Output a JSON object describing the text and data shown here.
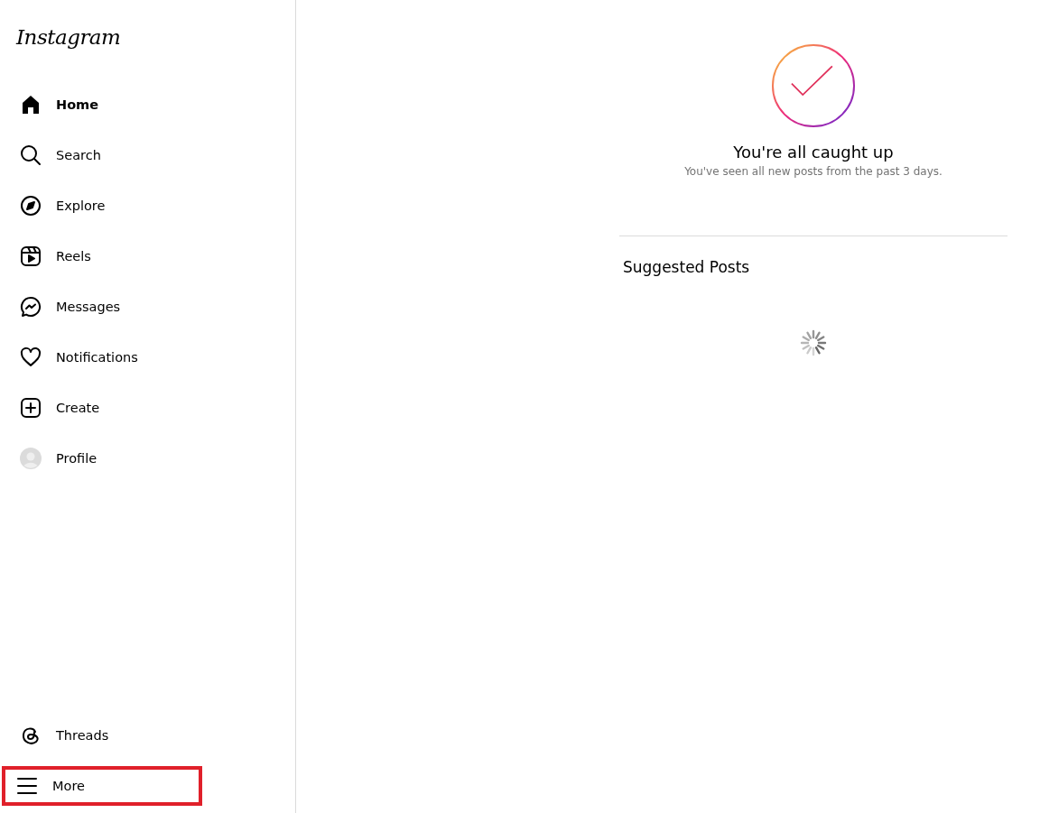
{
  "sidebar": {
    "logo": "Instagram",
    "items": [
      {
        "label": "Home",
        "kind": "home",
        "selected": true,
        "highlighted": false
      },
      {
        "label": "Search",
        "kind": "search",
        "selected": false,
        "highlighted": false
      },
      {
        "label": "Explore",
        "kind": "explore",
        "selected": false,
        "highlighted": false
      },
      {
        "label": "Reels",
        "kind": "reels",
        "selected": false,
        "highlighted": false
      },
      {
        "label": "Messages",
        "kind": "messages",
        "selected": false,
        "highlighted": false
      },
      {
        "label": "Notifications",
        "kind": "notifications",
        "selected": false,
        "highlighted": false
      },
      {
        "label": "Create",
        "kind": "create",
        "selected": false,
        "highlighted": false
      },
      {
        "label": "Profile",
        "kind": "profile",
        "selected": false,
        "highlighted": false
      }
    ],
    "bottom_items": [
      {
        "label": "Threads",
        "kind": "threads",
        "selected": false,
        "highlighted": false
      },
      {
        "label": "More",
        "kind": "menu",
        "selected": false,
        "highlighted": true
      }
    ]
  },
  "feed": {
    "caught_up": {
      "title": "You're all caught up",
      "subtitle": "You've seen all new posts from the past 3 days."
    },
    "suggested": {
      "heading": "Suggested Posts",
      "loading": true
    }
  }
}
